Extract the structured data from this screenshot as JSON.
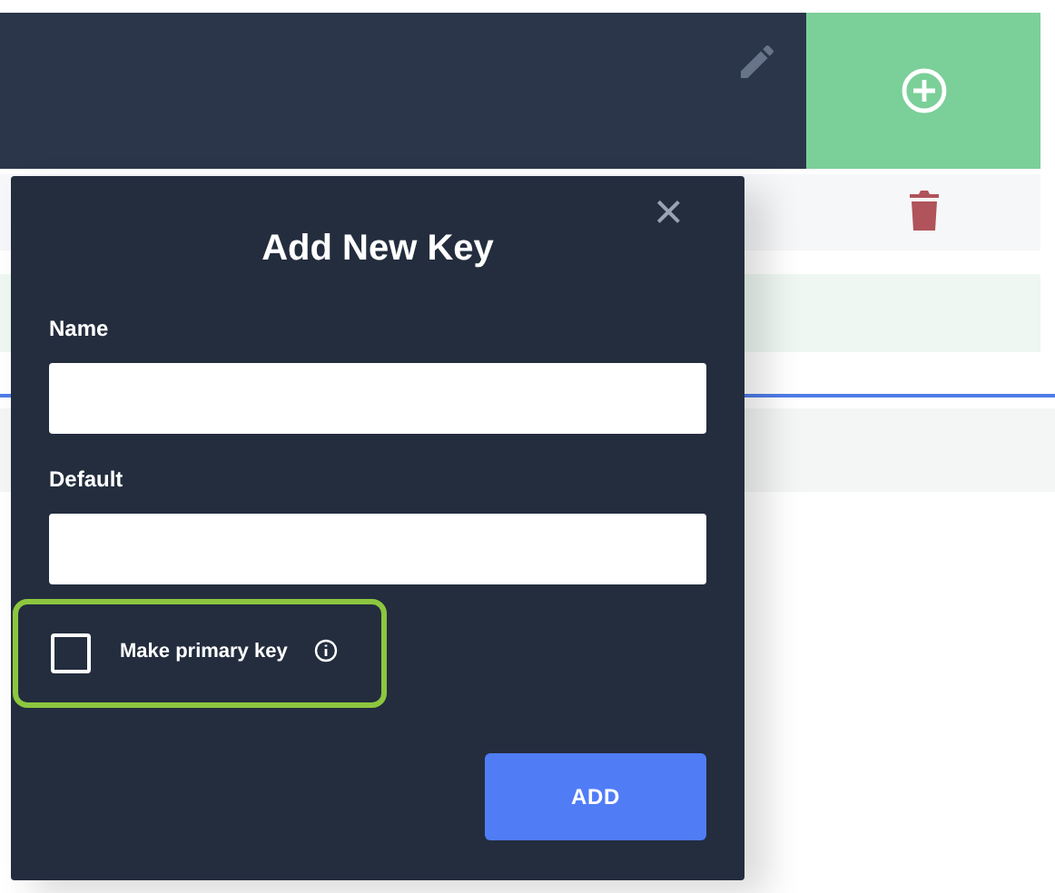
{
  "dialog": {
    "title": "Add New Key",
    "close": "×",
    "fields": [
      {
        "label": "Name"
      },
      {
        "label": "Default"
      }
    ],
    "primary_key": {
      "label": "Make primary key",
      "checked": false,
      "highlighted": true
    },
    "button": "ADD"
  }
}
